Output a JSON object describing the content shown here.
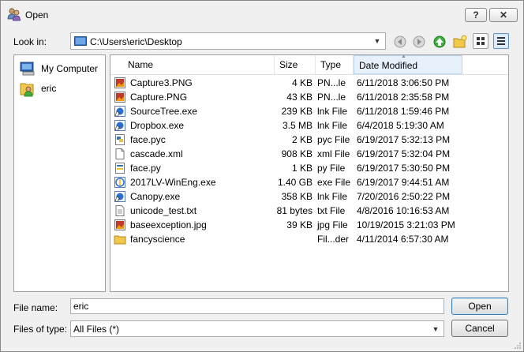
{
  "window": {
    "title": "Open",
    "help_label": "?",
    "close_label": "✕"
  },
  "lookin": {
    "label": "Look in:",
    "path": "C:\\Users\\eric\\Desktop"
  },
  "sidebar": {
    "items": [
      {
        "label": "My Computer",
        "icon": "computer-icon"
      },
      {
        "label": "eric",
        "icon": "user-folder-icon"
      }
    ]
  },
  "columns": {
    "name": "Name",
    "size": "Size",
    "type": "Type",
    "date": "Date Modified"
  },
  "files": [
    {
      "name": "Capture3.PNG",
      "size": "4 KB",
      "type": "PN...le",
      "date": "6/11/2018 3:06:50 PM",
      "icon": "image-icon"
    },
    {
      "name": "Capture.PNG",
      "size": "43 KB",
      "type": "PN...le",
      "date": "6/11/2018 2:35:58 PM",
      "icon": "image-icon"
    },
    {
      "name": "SourceTree.exe",
      "size": "239 KB",
      "type": "lnk File",
      "date": "6/11/2018 1:59:46 PM",
      "icon": "shortcut-icon"
    },
    {
      "name": "Dropbox.exe",
      "size": "3.5 MB",
      "type": "lnk File",
      "date": "6/4/2018 5:19:30 AM",
      "icon": "shortcut-icon"
    },
    {
      "name": "face.pyc",
      "size": "2 KB",
      "type": "pyc File",
      "date": "6/19/2017 5:32:13 PM",
      "icon": "python-compiled-icon"
    },
    {
      "name": "cascade.xml",
      "size": "908 KB",
      "type": "xml File",
      "date": "6/19/2017 5:32:04 PM",
      "icon": "document-icon"
    },
    {
      "name": "face.py",
      "size": "1 KB",
      "type": "py File",
      "date": "6/19/2017 5:30:50 PM",
      "icon": "python-script-icon"
    },
    {
      "name": "2017LV-WinEng.exe",
      "size": "1.40 GB",
      "type": "exe File",
      "date": "6/19/2017 9:44:51 AM",
      "icon": "installer-icon"
    },
    {
      "name": "Canopy.exe",
      "size": "358 KB",
      "type": "lnk File",
      "date": "7/20/2016 2:50:22 PM",
      "icon": "shortcut-icon"
    },
    {
      "name": "unicode_test.txt",
      "size": "81 bytes",
      "type": "txt File",
      "date": "4/8/2016 10:16:53 AM",
      "icon": "text-file-icon"
    },
    {
      "name": "baseexception.jpg",
      "size": "39 KB",
      "type": "jpg File",
      "date": "10/19/2015 3:21:03 PM",
      "icon": "image-icon"
    },
    {
      "name": "fancyscience",
      "size": "",
      "type": "Fil...der",
      "date": "4/11/2014 6:57:30 AM",
      "icon": "folder-icon"
    }
  ],
  "filename": {
    "label": "File name:",
    "value": "eric"
  },
  "filetype": {
    "label": "Files of type:",
    "value": "All Files (*)"
  },
  "buttons": {
    "open": "Open",
    "cancel": "Cancel"
  }
}
